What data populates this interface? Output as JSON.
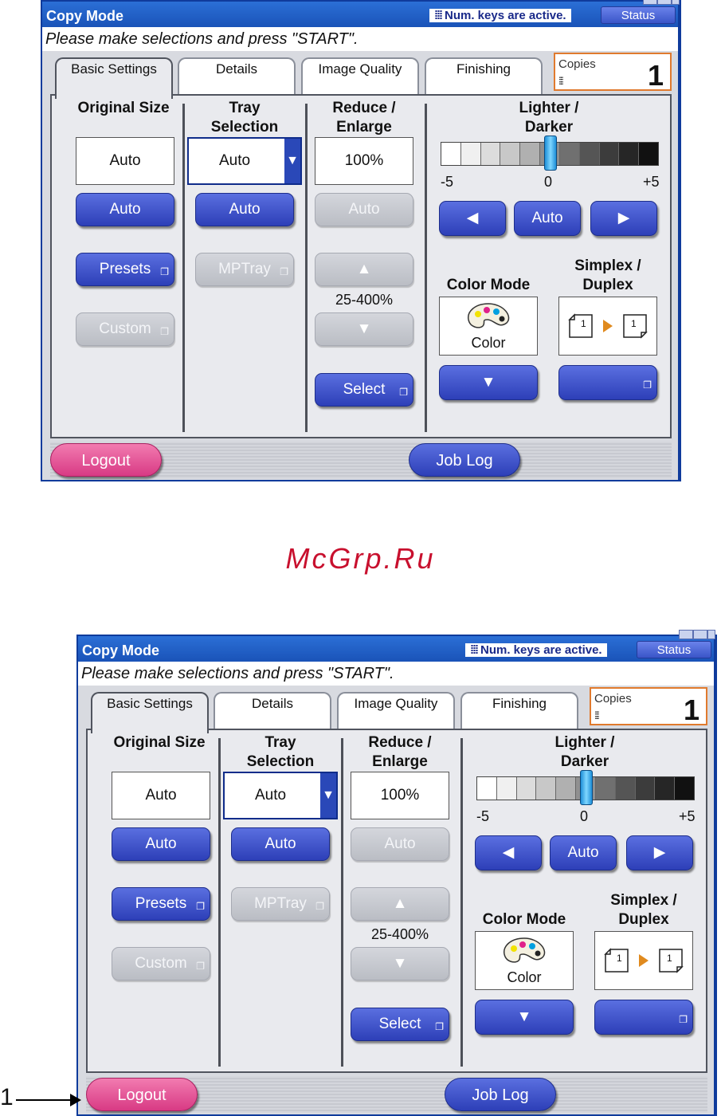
{
  "header": {
    "title": "Copy Mode",
    "num_keys_notice": "Num. keys are active.",
    "status_label": "Status"
  },
  "message": "Please make selections and press \"START\".",
  "tabs": [
    {
      "label": "Basic Settings",
      "active": true
    },
    {
      "label": "Details"
    },
    {
      "label": "Image Quality"
    },
    {
      "label": "Finishing"
    }
  ],
  "copies": {
    "label": "Copies",
    "value": "1"
  },
  "original_size": {
    "title": "Original Size",
    "value": "Auto",
    "auto_label": "Auto",
    "presets_label": "Presets",
    "custom_label": "Custom"
  },
  "tray": {
    "title_line1": "Tray",
    "title_line2": "Selection",
    "value": "Auto",
    "auto_label": "Auto",
    "mptray_label": "MPTray"
  },
  "reduce": {
    "title_line1": "Reduce /",
    "title_line2": "Enlarge",
    "value": "100%",
    "auto_label": "Auto",
    "range": "25-400%",
    "select_label": "Select"
  },
  "density": {
    "title_line1": "Lighter /",
    "title_line2": "Darker",
    "min_label": "-5",
    "mid_label": "0",
    "max_label": "+5",
    "auto_label": "Auto",
    "level": 0,
    "left_arrow": "◀",
    "right_arrow": "▶"
  },
  "color_mode": {
    "title": "Color Mode",
    "value": "Color",
    "down_arrow": "▼"
  },
  "duplex": {
    "title_line1": "Simplex /",
    "title_line2": "Duplex",
    "page_num": "1"
  },
  "footer": {
    "logout_label": "Logout",
    "joblog_label": "Job Log"
  },
  "watermark": "McGrp.Ru",
  "callout": "1",
  "colors": {
    "accent_blue": "#2d3fb8",
    "logout_pink": "#d83a84",
    "copies_border": "#e07a2e"
  }
}
